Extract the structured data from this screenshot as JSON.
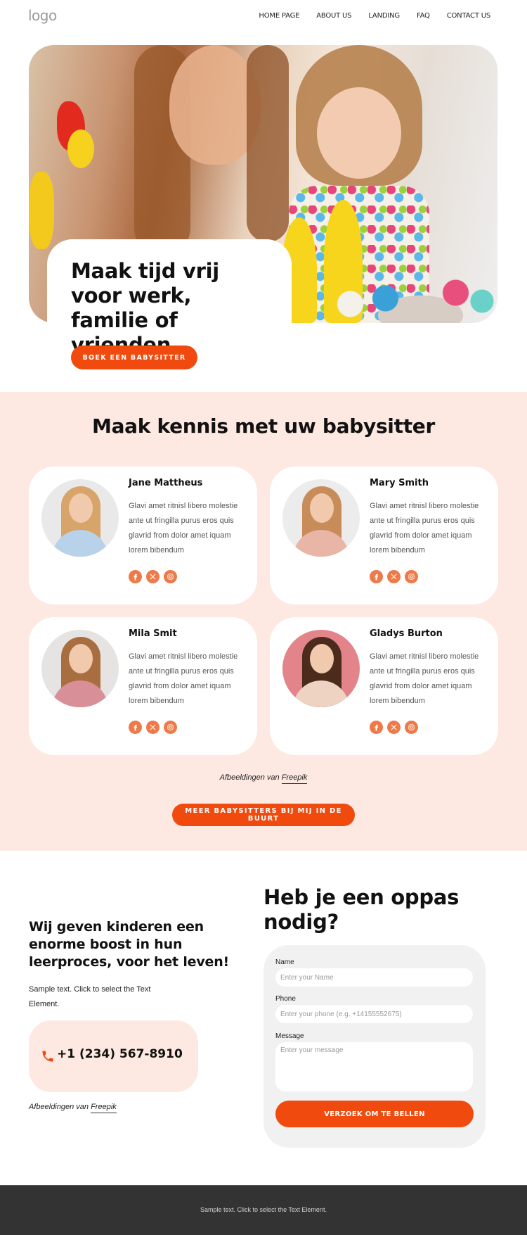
{
  "header": {
    "logo": "logo",
    "nav": [
      "HOME PAGE",
      "ABOUT US",
      "LANDING",
      "FAQ",
      "CONTACT US"
    ]
  },
  "hero": {
    "title": "Maak tijd vrij voor werk, familie of vrienden",
    "cta_label": "BOEK EEN BABYSITTER",
    "image_alt": "mother and daughter crafting easter decorations"
  },
  "sitters": {
    "title": "Maak kennis met uw babysitter",
    "cards": [
      {
        "name": "Jane Mattheus",
        "bio": "Glavi amet ritnisl libero molestie ante ut fringilla purus eros quis glavrid from dolor amet iquam lorem bibendum",
        "socials": [
          "facebook-icon",
          "x-icon",
          "instagram-icon"
        ]
      },
      {
        "name": "Mary Smith",
        "bio": "Glavi amet ritnisl libero molestie ante ut fringilla purus eros quis glavrid from dolor amet iquam lorem bibendum",
        "socials": [
          "facebook-icon",
          "x-icon",
          "instagram-icon"
        ]
      },
      {
        "name": "Mila Smit",
        "bio": "Glavi amet ritnisl libero molestie ante ut fringilla purus eros quis glavrid from dolor amet iquam lorem bibendum",
        "socials": [
          "facebook-icon",
          "x-icon",
          "instagram-icon"
        ]
      },
      {
        "name": "Gladys Burton",
        "bio": "Glavi amet ritnisl libero molestie ante ut fringilla purus eros quis glavrid from dolor amet iquam lorem bibendum",
        "socials": [
          "facebook-icon",
          "x-icon",
          "instagram-icon"
        ]
      }
    ],
    "credit_prefix": "Afbeeldingen van",
    "credit_link": "Freepik",
    "more_label": "MEER BABYSITTERS BIJ MIJ IN DE BUURT"
  },
  "contact": {
    "boost_title": "Wij geven kinderen een enorme boost in hun leerproces, voor het leven!",
    "boost_text": "Sample text. Click to select the Text Element.",
    "phone": "+1 (234) 567-8910",
    "credit_prefix": "Afbeeldingen van",
    "credit_link": "Freepik",
    "form": {
      "title": "Heb je een oppas nodig?",
      "name_label": "Name",
      "name_placeholder": "Enter your Name",
      "phone_label": "Phone",
      "phone_placeholder": "Enter your phone (e.g. +14155552675)",
      "message_label": "Message",
      "message_placeholder": "Enter your message",
      "submit_label": "VERZOEK OM TE BELLEN"
    }
  },
  "footer": {
    "text": "Sample text. Click to select the Text Element."
  },
  "colors": {
    "accent": "#f04a0e",
    "social_icon": "#ed7a48",
    "section_bg": "#fde9e1",
    "form_bg": "#f1f1f1",
    "footer_bg": "#333333"
  }
}
